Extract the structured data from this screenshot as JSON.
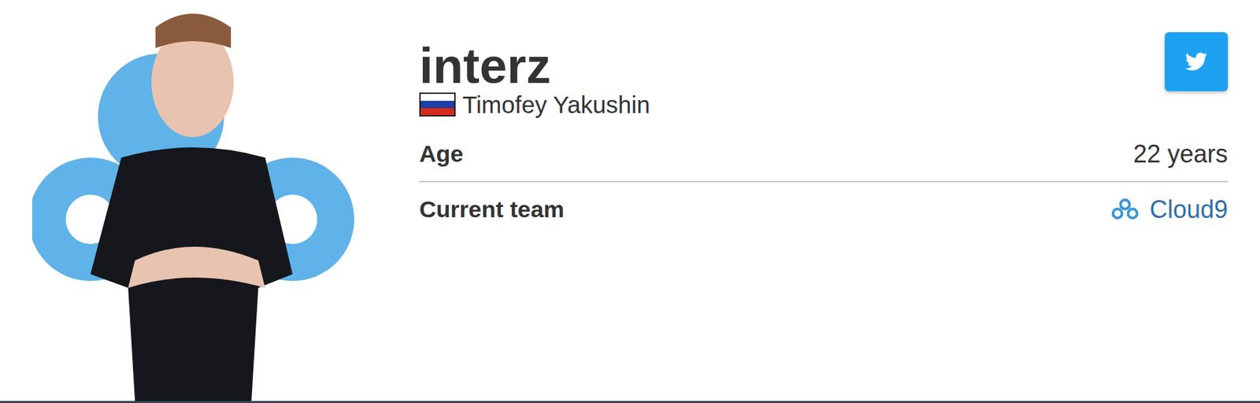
{
  "player": {
    "nickname": "interz",
    "real_name": "Timofey Yakushin"
  },
  "info_rows": [
    {
      "label": "Age",
      "value": "22 years",
      "kind": "text"
    },
    {
      "label": "Current team",
      "value": "Cloud9",
      "kind": "team"
    }
  ]
}
